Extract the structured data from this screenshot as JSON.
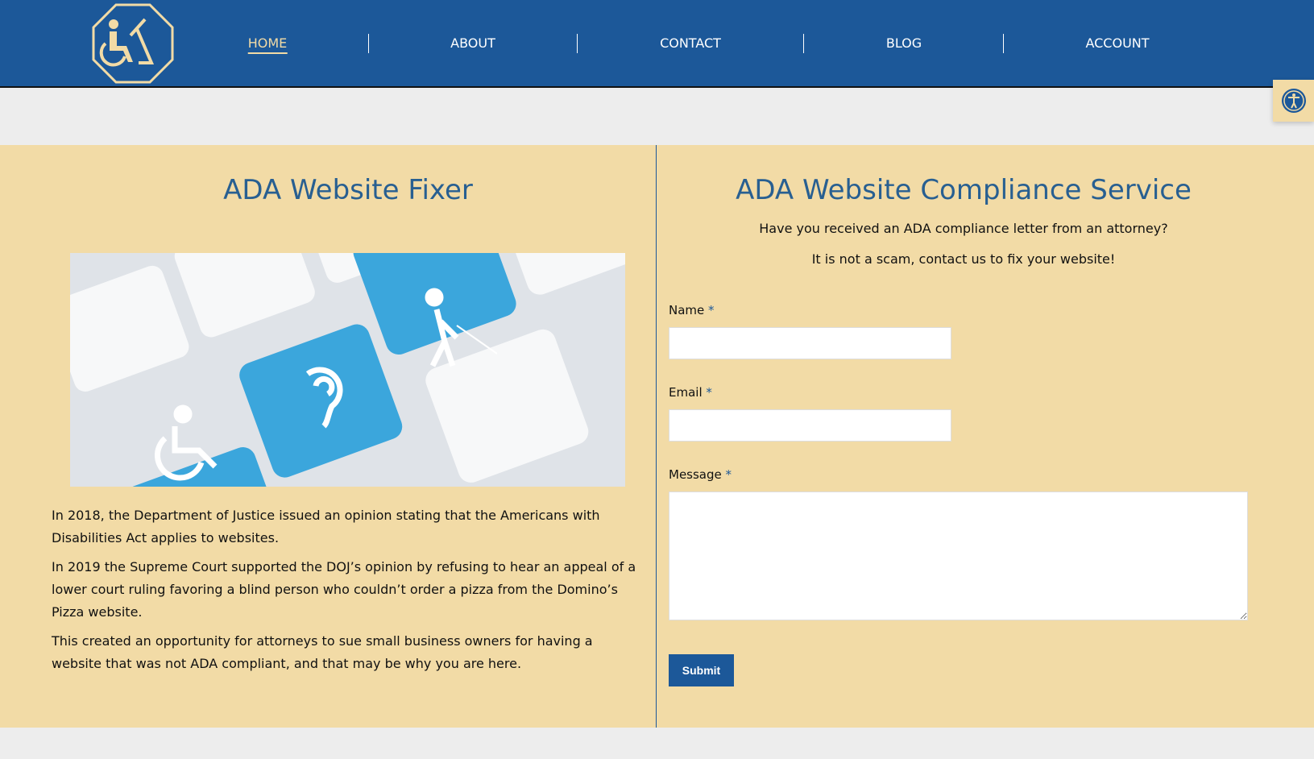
{
  "nav": {
    "items": [
      {
        "label": "HOME",
        "active": true
      },
      {
        "label": "ABOUT"
      },
      {
        "label": "CONTACT"
      },
      {
        "label": "BLOG"
      },
      {
        "label": "ACCOUNT"
      }
    ]
  },
  "colors": {
    "header": "#1c5899",
    "accent": "#f2dba6",
    "title": "#285f91",
    "gray": "#ededed"
  },
  "icons": {
    "logo": "wheelchair-octagon-logo",
    "a11y": "accessibility-icon"
  },
  "left": {
    "title": "ADA Website Fixer",
    "paragraphs": [
      "In 2018, the Department of Justice issued an opinion stating that the Americans with Disabilities Act applies to websites.",
      "In 2019 the Supreme Court supported the DOJ’s opinion by refusing to hear an appeal of a lower court ruling favoring a blind person who couldn’t order a pizza from the Domino’s Pizza website.",
      "This created an opportunity for attorneys to sue small business owners for having a website that was not ADA compliant, and that may be why you are here."
    ]
  },
  "right": {
    "title": "ADA Website Compliance Service",
    "line1": "Have you received an ADA compliance letter from an attorney?",
    "line2": "It is not a scam, contact us to fix your website!",
    "form": {
      "name_label": "Name",
      "email_label": "Email",
      "message_label": "Message",
      "required": "*",
      "name_value": "",
      "email_value": "",
      "message_value": "",
      "submit": "Submit"
    }
  }
}
